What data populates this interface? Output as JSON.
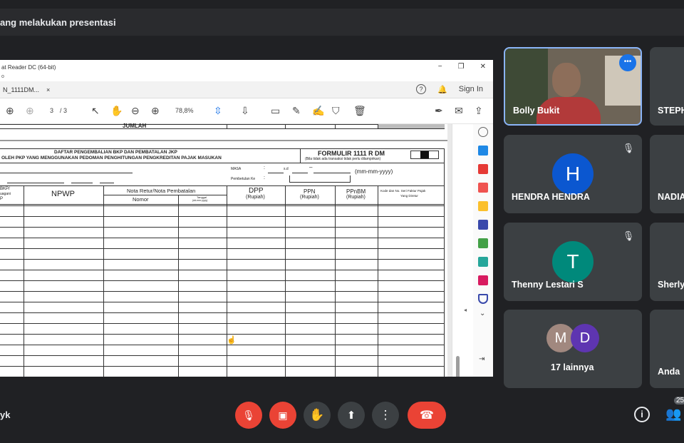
{
  "top": {
    "title": "ang melakukan presentasi"
  },
  "reader": {
    "app_title": "at Reader DC (64-bit)",
    "sub": "o",
    "tab_label": "N_1111DM...",
    "tab_close": "×",
    "sign_in": "Sign In",
    "page_current": "3",
    "page_sep": "/  3",
    "zoom": "78,8%",
    "win_min": "−",
    "win_max": "❐",
    "win_close": "✕"
  },
  "form": {
    "jumlah": "JUMLAH",
    "title1": "DAFTAR PENGEMBALIAN BKP DAN PEMBATALAN JKP",
    "title2": "OLEH PKP YANG MENGGUNAKAN PEDOMAN PENGHITUNGAN PENGKREDITAN PAJAK MASUKAN",
    "formulir": "FORMULIR 1111 R DM",
    "formulir_note": "(Bila tidak ada transaksi tidak perlu dilampirkan)",
    "masa": "MASA",
    "colon1": ":",
    "sd": "s.d",
    "dash": "–",
    "date_fmt": "(mm-mm-yyyy)",
    "pembetulan": "Pembetulan Ke",
    "colon2": ":",
    "col_bkp": "BKP/",
    "col_bkp2": "uagani",
    "col_bkp3": "P",
    "col_npwp": "NPWP",
    "col_nota": "Nota Retur/Nota Pembatalan",
    "col_nomor": "Nomor",
    "col_tanggal": "Tanggal",
    "col_tanggal2": "(dd-mm-yyyy)",
    "col_dpp": "DPP",
    "col_ppn": "PPN",
    "col_ppnbm": "PPnBM",
    "rupiah": "(Rupiah)",
    "col_kode": "Kode dan No. Seri Faktur Pajak",
    "col_kode2": "Yang Diretur"
  },
  "participants": [
    {
      "name": "Bolly Bukit",
      "more": "•••"
    },
    {
      "name": "STEPH"
    },
    {
      "name": "HENDRA HENDRA",
      "initial": "H",
      "color": "#0b57d0"
    },
    {
      "name": "NADIA"
    },
    {
      "name": "Thenny Lestari S",
      "initial": "T",
      "color": "#00897b"
    },
    {
      "name": "Sherly"
    },
    {
      "name": "17 lainnya",
      "initial_a": "M",
      "initial_b": "D",
      "color_a": "#a1887f",
      "color_b": "#5e35b1"
    },
    {
      "name": "Anda"
    }
  ],
  "bottom": {
    "left_name": "yk",
    "count": "25"
  }
}
